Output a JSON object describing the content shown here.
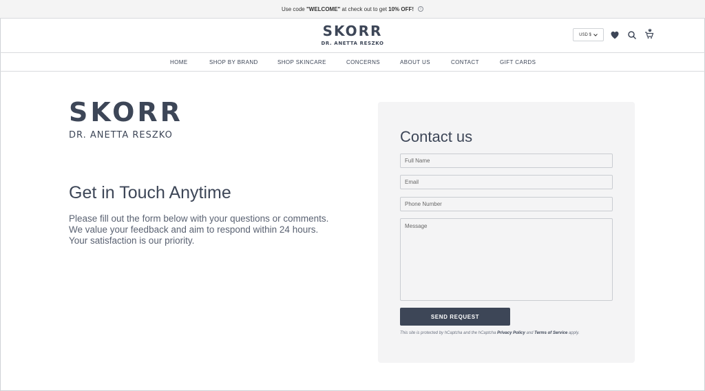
{
  "promo": {
    "prefix": "Use code ",
    "code": "\"WELCOME\"",
    "middle": " at check out to get ",
    "discount": "10% OFF!",
    "info_icon": "info-icon"
  },
  "header": {
    "logo_brand": "SKORR",
    "logo_sub": "DR. ANETTA RESZKO",
    "currency": "USD $",
    "icons": [
      "heart-icon",
      "search-icon",
      "cart-icon"
    ],
    "cart_count": "0"
  },
  "nav": {
    "items": [
      "HOME",
      "SHOP BY BRAND",
      "SHOP SKINCARE",
      "CONCERNS",
      "ABOUT US",
      "CONTACT",
      "GIFT CARDS"
    ]
  },
  "hero": {
    "logo_brand": "SKORR",
    "logo_sub": "DR. ANETTA RESZKO",
    "title": "Get in Touch Anytime",
    "text": "Please fill out the form below with your questions or comments. We value your feedback and aim to respond within 24 hours. Your satisfaction is our priority."
  },
  "form": {
    "title": "Contact us",
    "full_name_placeholder": "Full Name",
    "email_placeholder": "Email",
    "phone_placeholder": "Phone Number",
    "message_placeholder": "Message",
    "submit_label": "SEND REQUEST",
    "legal_prefix": "This site is protected by hCaptcha and the hCaptcha ",
    "privacy_label": "Privacy Policy",
    "legal_and": " and ",
    "terms_label": "Terms of Service",
    "legal_suffix": " apply."
  },
  "colors": {
    "brand": "#3d4657",
    "panel_bg": "#f4f4f5",
    "promo_bg": "#f4f4f4"
  }
}
